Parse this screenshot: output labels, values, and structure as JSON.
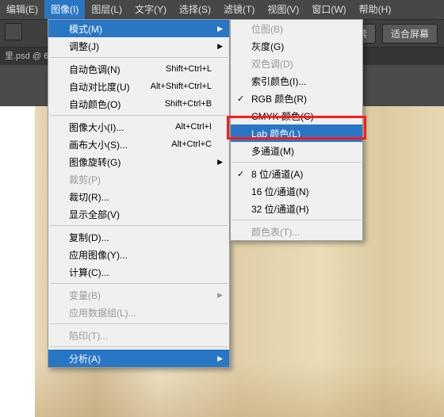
{
  "menubar": {
    "items": [
      "编辑(E)",
      "图像(I)",
      "图层(L)",
      "文字(Y)",
      "选择(S)",
      "滤镜(T)",
      "视图(V)",
      "窗口(W)",
      "帮助(H)"
    ],
    "active_index": 1
  },
  "toolbar": {
    "btn1": "素",
    "btn2": "适合屏幕"
  },
  "tabbar": {
    "label": "里.psd @ 6"
  },
  "menu1": {
    "groups": [
      [
        {
          "label": "模式(M)",
          "arrow": true,
          "hovered": true
        },
        {
          "label": "调整(J)",
          "arrow": true
        }
      ],
      [
        {
          "label": "自动色调(N)",
          "shortcut": "Shift+Ctrl+L"
        },
        {
          "label": "自动对比度(U)",
          "shortcut": "Alt+Shift+Ctrl+L"
        },
        {
          "label": "自动颜色(O)",
          "shortcut": "Shift+Ctrl+B"
        }
      ],
      [
        {
          "label": "图像大小(I)...",
          "shortcut": "Alt+Ctrl+I"
        },
        {
          "label": "画布大小(S)...",
          "shortcut": "Alt+Ctrl+C"
        },
        {
          "label": "图像旋转(G)",
          "arrow": true
        },
        {
          "label": "裁剪(P)",
          "disabled": true
        },
        {
          "label": "裁切(R)..."
        },
        {
          "label": "显示全部(V)"
        }
      ],
      [
        {
          "label": "复制(D)..."
        },
        {
          "label": "应用图像(Y)..."
        },
        {
          "label": "计算(C)..."
        }
      ],
      [
        {
          "label": "变量(B)",
          "arrow": true,
          "disabled": true
        },
        {
          "label": "应用数据组(L)...",
          "disabled": true
        }
      ],
      [
        {
          "label": "陷印(T)...",
          "disabled": true
        }
      ],
      [
        {
          "label": "分析(A)",
          "arrow": true,
          "hovered": true
        }
      ]
    ]
  },
  "menu2": {
    "groups": [
      [
        {
          "label": "位图(B)",
          "disabled": true
        },
        {
          "label": "灰度(G)"
        },
        {
          "label": "双色调(D)",
          "disabled": true
        },
        {
          "label": "索引颜色(I)..."
        },
        {
          "label": "RGB 颜色(R)",
          "checked": true
        },
        {
          "label": "CMYK 颜色(C)"
        },
        {
          "label": "Lab 颜色(L)",
          "highlighted": true
        },
        {
          "label": "多通道(M)"
        }
      ],
      [
        {
          "label": "8 位/通道(A)",
          "checked": true
        },
        {
          "label": "16 位/通道(N)"
        },
        {
          "label": "32 位/通道(H)"
        }
      ],
      [
        {
          "label": "颜色表(T)...",
          "disabled": true
        }
      ]
    ]
  }
}
